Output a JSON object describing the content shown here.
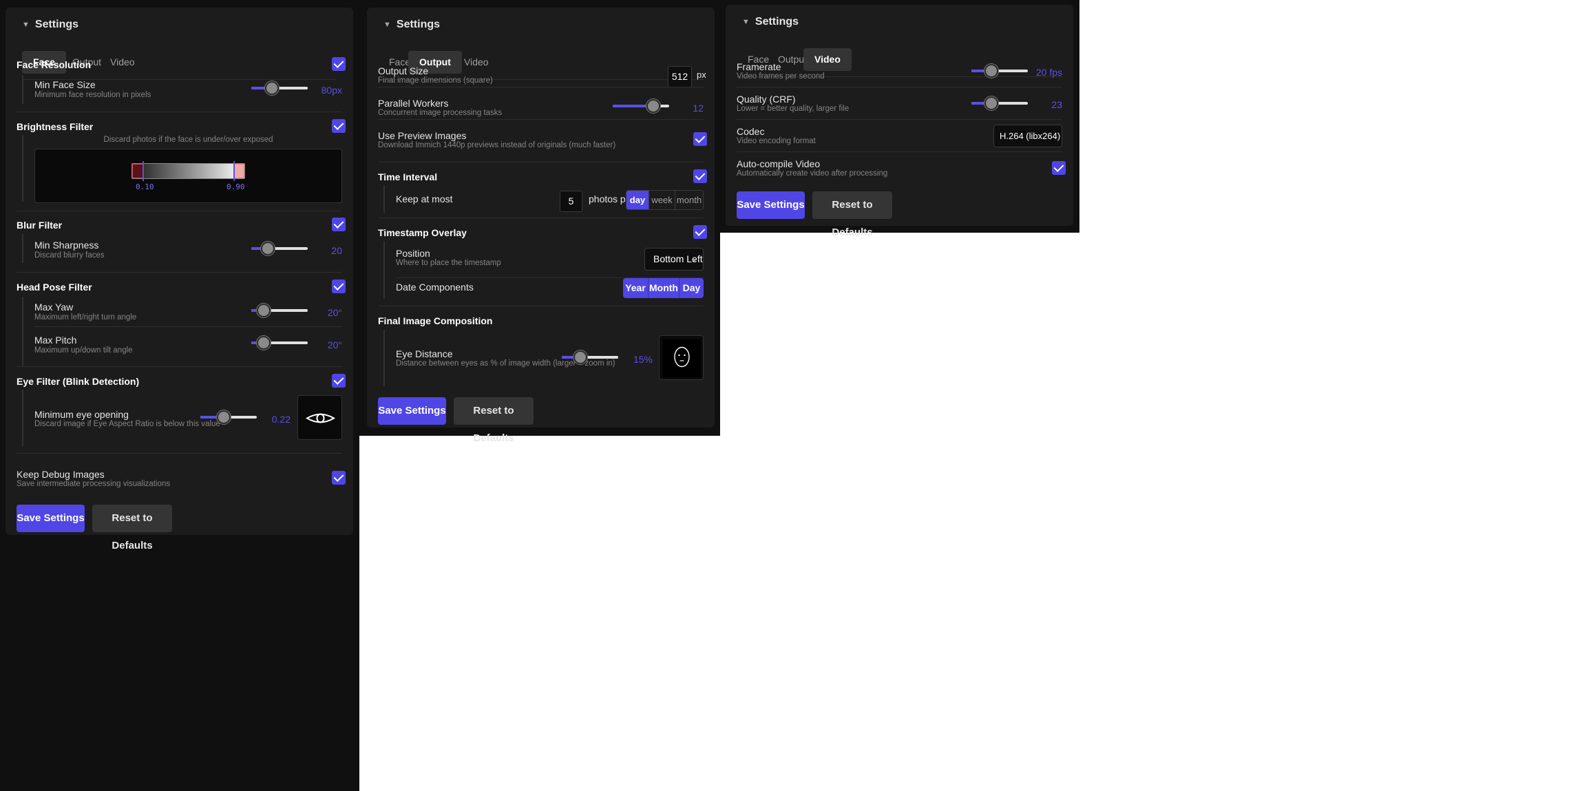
{
  "panel_title": "Settings",
  "tabs": [
    "Face",
    "Output",
    "Video"
  ],
  "accent_color": "#5046e5",
  "face": {
    "face_resolution": {
      "title": "Face Resolution",
      "label": "Min Face Size",
      "desc": "Minimum face resolution in pixels",
      "value": "80px",
      "level": 0.37
    },
    "brightness": {
      "title": "Brightness Filter",
      "desc": "Discard photos if the face is under/over exposed",
      "low": "0.10",
      "high": "0.90"
    },
    "blur": {
      "title": "Blur Filter",
      "label": "Min Sharpness",
      "desc": "Discard blurry faces",
      "value": "20",
      "level": 0.29
    },
    "head_pose": {
      "title": "Head Pose Filter",
      "yaw": {
        "label": "Max Yaw",
        "desc": "Maximum left/right turn angle",
        "value": "20°",
        "level": 0.22
      },
      "pitch": {
        "label": "Max Pitch",
        "desc": "Maximum up/down tilt angle",
        "value": "20°",
        "level": 0.22
      }
    },
    "eye": {
      "title": "Eye Filter (Blink Detection)",
      "label": "Minimum eye opening",
      "desc": "Discard image if Eye Aspect Ratio is below this value",
      "value": "0.22",
      "level": 0.42
    },
    "debug": {
      "label": "Keep Debug Images",
      "desc": "Save intermediate processing visualizations"
    }
  },
  "output": {
    "size": {
      "label": "Output Size",
      "desc": "Final image dimensions (square)",
      "value": "512",
      "unit": "px"
    },
    "workers": {
      "label": "Parallel Workers",
      "desc": "Concurrent image processing tasks",
      "value": "12",
      "level": 0.72
    },
    "preview": {
      "label": "Use Preview Images",
      "desc": "Download Immich 1440p previews instead of originals (much faster)"
    },
    "time_interval": {
      "title": "Time Interval",
      "label": "Keep at most",
      "count": "5",
      "suffix": "photos per",
      "options": [
        "day",
        "week",
        "month"
      ],
      "selected": "day"
    },
    "timestamp": {
      "title": "Timestamp Overlay",
      "position_label": "Position",
      "position_desc": "Where to place the timestamp",
      "position_value": "Bottom Left",
      "components_label": "Date Components",
      "components": [
        "Year",
        "Month",
        "Day"
      ]
    },
    "composition": {
      "title": "Final Image Composition",
      "label": "Eye Distance",
      "desc": "Distance between eyes as % of image width (larger = zoom in)",
      "value": "15%",
      "level": 0.33
    }
  },
  "video": {
    "framerate": {
      "label": "Framerate",
      "desc": "Video frames per second",
      "value": "20 fps",
      "level": 0.35
    },
    "quality": {
      "label": "Quality (CRF)",
      "desc": "Lower = better quality, larger file",
      "value": "23",
      "level": 0.35
    },
    "codec": {
      "label": "Codec",
      "desc": "Video encoding format",
      "value": "H.264 (libx264)"
    },
    "auto": {
      "label": "Auto-compile Video",
      "desc": "Automatically create video after processing"
    }
  },
  "buttons": {
    "save": "Save Settings",
    "reset": "Reset to Defaults"
  }
}
